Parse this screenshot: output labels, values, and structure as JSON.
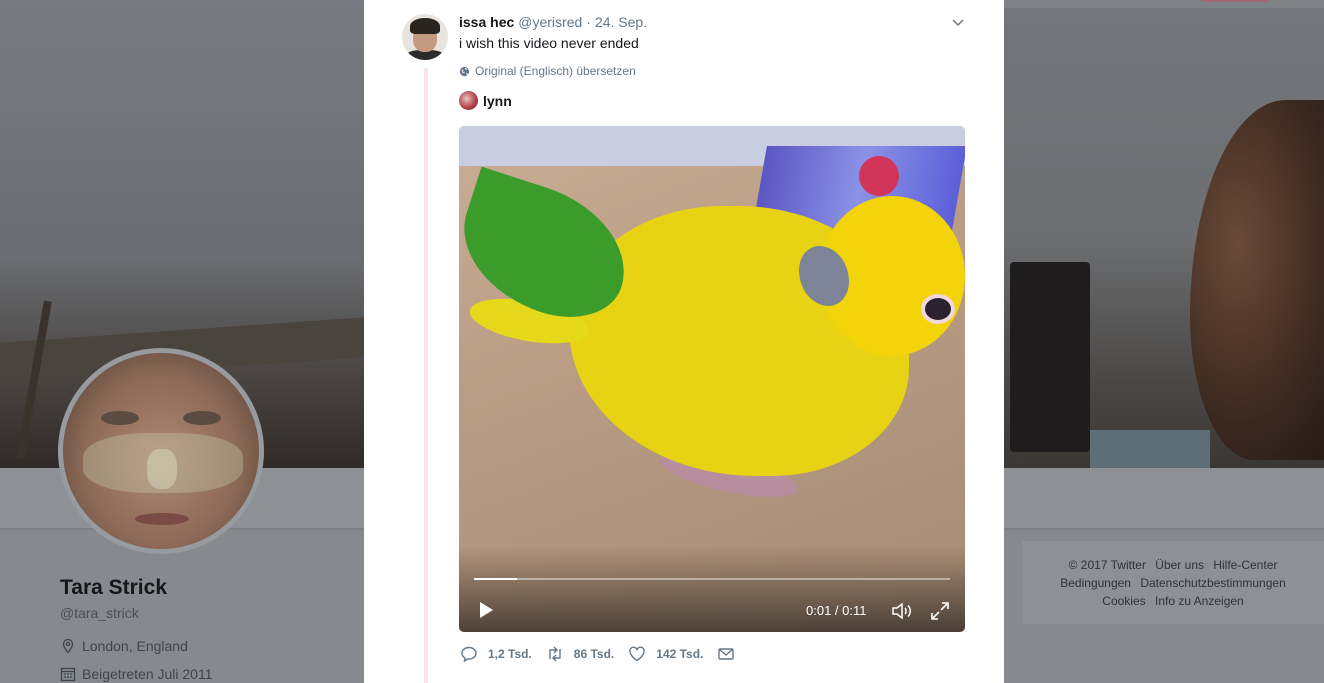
{
  "background_profile": {
    "name": "Tara Strick",
    "handle": "@tara_strick",
    "location": "London, England",
    "joined": "Beigetreten Juli 2011"
  },
  "footer": {
    "copyright": "© 2017 Twitter",
    "links_row1": [
      "Über uns",
      "Hilfe-Center"
    ],
    "links_row2": [
      "Bedingungen",
      "Datenschutzbestimmungen"
    ],
    "links_row3": [
      "Cookies",
      "Info zu Anzeigen"
    ]
  },
  "tweet": {
    "author_name": "issa hec",
    "author_handle": "@yerisred",
    "separator": "·",
    "date": "24. Sep.",
    "text": "i wish this video never ended",
    "translate_label": "Original (Englisch) übersetzen",
    "attribution_name": "lynn",
    "video": {
      "time": "0:01 / 0:11",
      "progress_fraction": 0.09
    },
    "actions": {
      "replies": "1,2 Tsd.",
      "retweets": "86 Tsd.",
      "likes": "142 Tsd."
    }
  },
  "icons": {
    "chevron": "chevron-down-icon",
    "globe": "globe-icon",
    "play": "play-icon",
    "volume": "volume-icon",
    "fullscreen": "fullscreen-icon",
    "reply": "reply-icon",
    "retweet": "retweet-icon",
    "like": "heart-icon",
    "dm": "envelope-icon",
    "location": "location-pin-icon",
    "calendar": "calendar-icon"
  },
  "colors": {
    "thread_line": "#fbe3e6",
    "secondary_text": "#657786",
    "primary_text": "#14171a"
  }
}
